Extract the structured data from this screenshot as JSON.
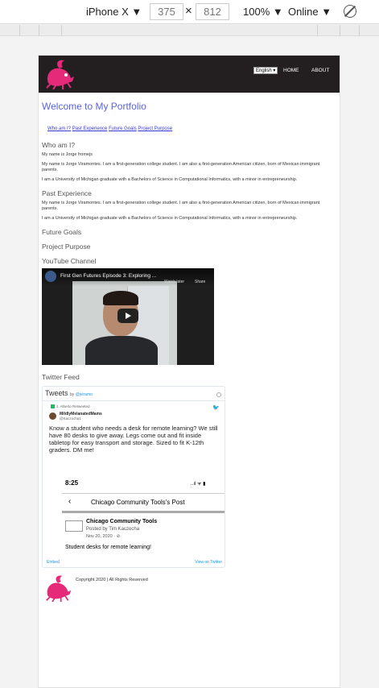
{
  "devtools": {
    "device": "iPhone X ▼",
    "width": "375",
    "times": "×",
    "height": "812",
    "zoom": "100% ▼",
    "network": "Online ▼"
  },
  "nav": {
    "language": "English ▾",
    "home": "HOME",
    "about": "ABOUT"
  },
  "page": {
    "title": "Welcome to My Portfolio",
    "links": [
      "Who am I?",
      "Past Experience",
      "Future Goals",
      "Project Purpose"
    ],
    "who_heading": "Who am I?",
    "who_p1": "My name is Jorge fromejs",
    "who_p2": "My name is Jorge Viramontes. I am a first-generation college student. I am also a first-generation American citizen, born of Mexican immigrant parents.",
    "who_p3": "I am a University of Michigan graduate with a Bachelors of Science in Computational Informatics, with a minor in entrepreneurship.",
    "past_heading": "Past Experience",
    "past_p1": "My name is Jorge Viramontes. I am a first-generation college student. I am also a first-generation American citizen, born of Mexican immigrant parents.",
    "past_p2": "I am a University of Michigan graduate with a Bachelors of Science in Computational Informatics, with a minor in entrepreneurship.",
    "goals_heading": "Future Goals",
    "purpose_heading": "Project Purpose",
    "youtube_heading": "YouTube Channel",
    "twitter_heading": "Twitter Feed",
    "copyright": "Copyright 2020 | All Rights Reserved"
  },
  "video": {
    "title": "First Gen Futures Episode 3: Exploring ...",
    "watch_later": "Watch later",
    "share": "Share"
  },
  "twitter": {
    "header": "Tweets",
    "by": "by",
    "by_handle": "@jviramo",
    "retweeted": "J. Alberto Retweeted",
    "user": "MildlyMelanatedMams",
    "handle": "@Kaczocha1",
    "text": "Know a student who needs a desk for remote learning? We still have 80 desks to give away. Legs come out and fit inside tabletop for easy transport and storage. Sized to fit  K-12th graders. DM me!",
    "shot_time": "8:25",
    "shot_signal": "..ıl ᯤ ▮",
    "shot_back": "‹",
    "shot_title": "Chicago Community Tools's Post",
    "shot_name": "Chicago Community Tools",
    "shot_by": "Posted by Tim Kaczocha",
    "shot_date": "Nov 20, 2020 · ⊘",
    "shot_body": "Student desks for remote learning!",
    "embed": "Embed",
    "view": "View on Twitter"
  }
}
